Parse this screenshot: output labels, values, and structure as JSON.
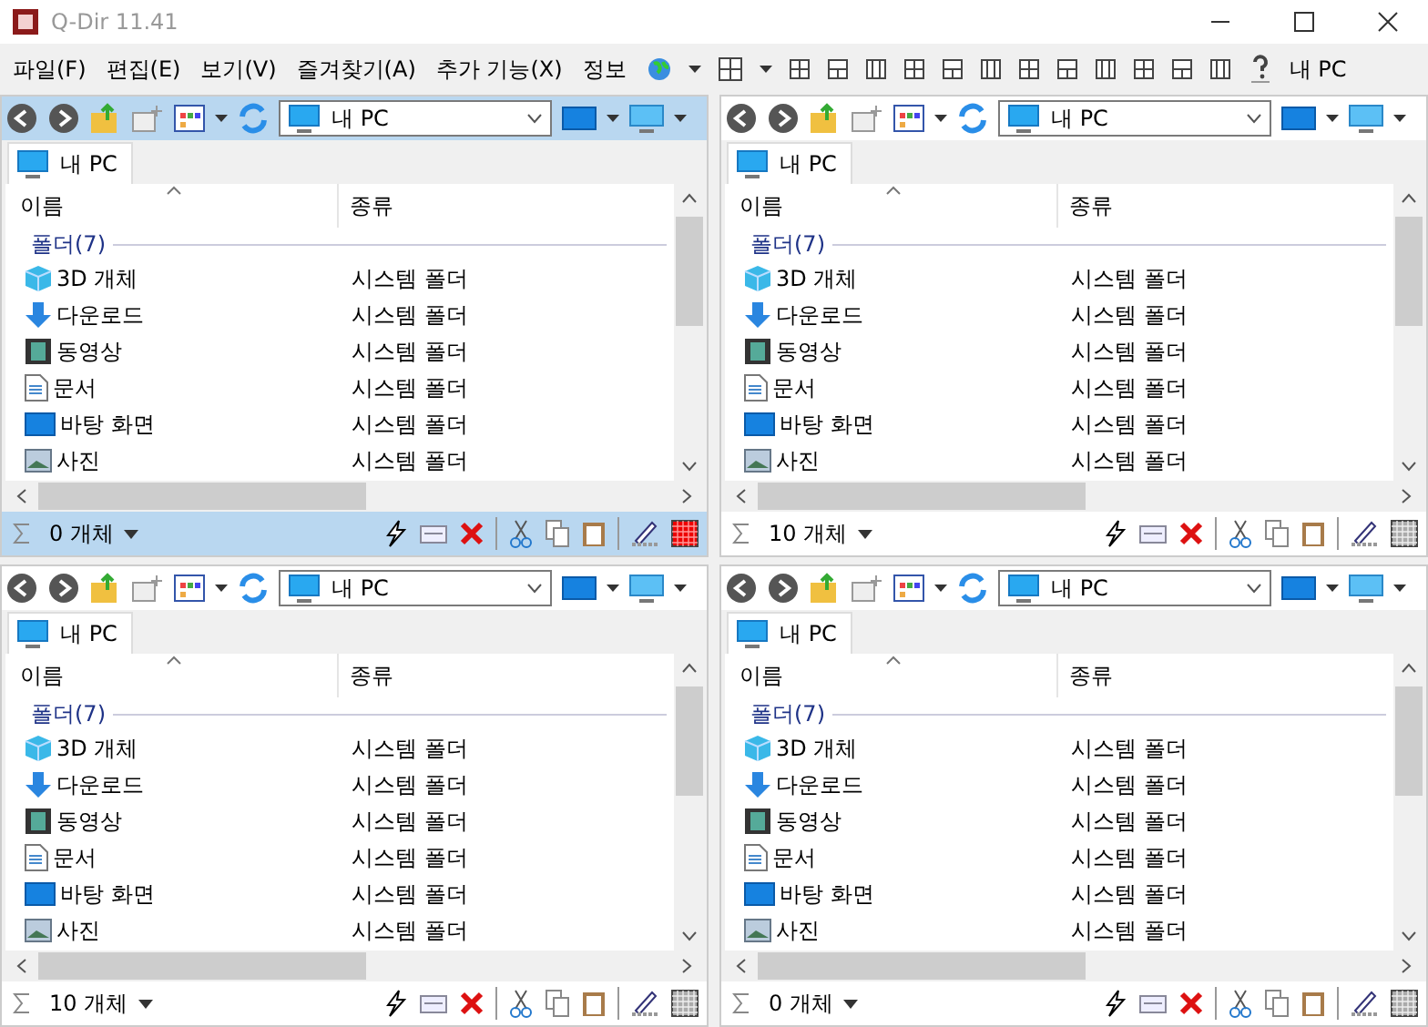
{
  "window": {
    "title": "Q-Dir 11.41"
  },
  "menu": [
    {
      "label": "파일(F)"
    },
    {
      "label": "편집(E)"
    },
    {
      "label": "보기(V)"
    },
    {
      "label": "즐겨찾기(A)"
    },
    {
      "label": "추가 기능(X)"
    },
    {
      "label": "정보"
    }
  ],
  "toolbar": {
    "location": "내 PC"
  },
  "panes": [
    {
      "active": true,
      "address": "내 PC",
      "tab": "내 PC",
      "columns": [
        "이름",
        "종류"
      ],
      "group": "폴더(7)",
      "status": "0 개체",
      "rows": [
        {
          "kind": "cube",
          "name": "3D 개체",
          "type": "시스템 폴더"
        },
        {
          "kind": "download",
          "name": "다운로드",
          "type": "시스템 폴더"
        },
        {
          "kind": "video",
          "name": "동영상",
          "type": "시스템 폴더"
        },
        {
          "kind": "document",
          "name": "문서",
          "type": "시스템 폴더"
        },
        {
          "kind": "desktop",
          "name": "바탕 화면",
          "type": "시스템 폴더"
        },
        {
          "kind": "pictures",
          "name": "사진",
          "type": "시스템 폴더"
        }
      ]
    },
    {
      "active": false,
      "address": "내 PC",
      "tab": "내 PC",
      "columns": [
        "이름",
        "종류"
      ],
      "group": "폴더(7)",
      "status": "10 개체",
      "rows": [
        {
          "kind": "cube",
          "name": "3D 개체",
          "type": "시스템 폴더"
        },
        {
          "kind": "download",
          "name": "다운로드",
          "type": "시스템 폴더"
        },
        {
          "kind": "video",
          "name": "동영상",
          "type": "시스템 폴더"
        },
        {
          "kind": "document",
          "name": "문서",
          "type": "시스템 폴더"
        },
        {
          "kind": "desktop",
          "name": "바탕 화면",
          "type": "시스템 폴더"
        },
        {
          "kind": "pictures",
          "name": "사진",
          "type": "시스템 폴더"
        }
      ]
    },
    {
      "active": false,
      "address": "내 PC",
      "tab": "내 PC",
      "columns": [
        "이름",
        "종류"
      ],
      "group": "폴더(7)",
      "status": "10 개체",
      "rows": [
        {
          "kind": "cube",
          "name": "3D 개체",
          "type": "시스템 폴더"
        },
        {
          "kind": "download",
          "name": "다운로드",
          "type": "시스템 폴더"
        },
        {
          "kind": "video",
          "name": "동영상",
          "type": "시스템 폴더"
        },
        {
          "kind": "document",
          "name": "문서",
          "type": "시스템 폴더"
        },
        {
          "kind": "desktop",
          "name": "바탕 화면",
          "type": "시스템 폴더"
        },
        {
          "kind": "pictures",
          "name": "사진",
          "type": "시스템 폴더"
        }
      ]
    },
    {
      "active": false,
      "address": "내 PC",
      "tab": "내 PC",
      "columns": [
        "이름",
        "종류"
      ],
      "group": "폴더(7)",
      "status": "0 개체",
      "rows": [
        {
          "kind": "cube",
          "name": "3D 개체",
          "type": "시스템 폴더"
        },
        {
          "kind": "download",
          "name": "다운로드",
          "type": "시스템 폴더"
        },
        {
          "kind": "video",
          "name": "동영상",
          "type": "시스템 폴더"
        },
        {
          "kind": "document",
          "name": "문서",
          "type": "시스템 폴더"
        },
        {
          "kind": "desktop",
          "name": "바탕 화면",
          "type": "시스템 폴더"
        },
        {
          "kind": "pictures",
          "name": "사진",
          "type": "시스템 폴더"
        }
      ]
    }
  ]
}
